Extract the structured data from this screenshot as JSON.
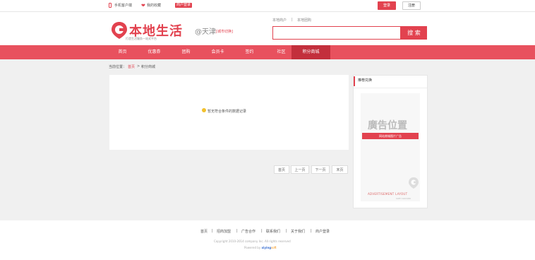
{
  "topbar": {
    "mobile_label": "手机客户端",
    "favorite_label": "我的收藏",
    "merchant_badge": "商户登录",
    "login_label": "登录",
    "register_label": "注册"
  },
  "header": {
    "logo_text": "本地生活",
    "logo_sub": "打造生活服务一站式平台",
    "city": "@天津",
    "city_switch": "[城市切换]",
    "search_tabs": [
      "本地商户",
      "本地团购"
    ],
    "search_placeholder": "",
    "search_button": "搜 索"
  },
  "nav": {
    "items": [
      "首页",
      "优惠券",
      "团购",
      "会员卡",
      "签约",
      "社区",
      "积分商城"
    ],
    "active_index": 6
  },
  "breadcrumb": {
    "prefix": "当前位置：",
    "home": "首页",
    "sep": ">",
    "current": "积分商城"
  },
  "main": {
    "empty_message": "暂无符合条件的数据记录"
  },
  "pager": {
    "first": "首页",
    "prev": "上一页",
    "next": "下一页",
    "last": "末页"
  },
  "sidebar": {
    "title": "推荐兑换",
    "ad_title": "廣告位置",
    "ad_red_text": "网站商城图片广告",
    "ad_en": "ADVERTISEMENT LAYOUT",
    "ad_en_sub": "SIZE 190X280"
  },
  "footer": {
    "links": [
      "首页",
      "招商加盟",
      "广告合作",
      "联系我们",
      "关于我们",
      "商户登录"
    ],
    "copyright": "Copyright 2010-2014 company Inc. All rights reserved",
    "powered_prefix": "Powered by",
    "powered_brand": "xiying",
    "powered_suffix": "soft"
  },
  "colors": {
    "accent": "#e2424f",
    "nav_bg": "#e8515e",
    "nav_active": "#c32f3c"
  }
}
